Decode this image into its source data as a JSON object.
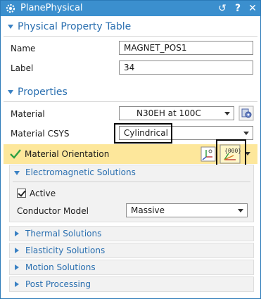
{
  "window": {
    "title": "PlanePhysical"
  },
  "physical_property_table": {
    "heading": "Physical Property Table",
    "name_label": "Name",
    "name_value": "MAGNET_POS1",
    "label_label": "Label",
    "label_value": "34"
  },
  "properties": {
    "heading": "Properties",
    "material_label": "Material",
    "material_value": "N30EH at 100C",
    "material_csys_label": "Material CSYS",
    "material_csys_value": "Cylindrical",
    "material_orientation_label": "Material Orientation"
  },
  "electromagnetic": {
    "heading": "Electromagnetic Solutions",
    "active_label": "Active",
    "active_checked": true,
    "conductor_model_label": "Conductor Model",
    "conductor_model_value": "Massive"
  },
  "collapsed_sections": [
    "Thermal Solutions",
    "Elasticity Solutions",
    "Motion Solutions",
    "Post Processing"
  ],
  "colors": {
    "titlebar": "#3b8fce",
    "accent_text": "#2a6fb0",
    "orientation_highlight": "#fde79b",
    "check_green": "#2ea043"
  },
  "icons": {
    "title": "gear-icon",
    "reset": "reset-icon",
    "help": "help-icon",
    "close": "close-icon",
    "material_library": "material-library-icon",
    "csys": "csys-icon",
    "orientation": "orientation-vectors-icon"
  }
}
